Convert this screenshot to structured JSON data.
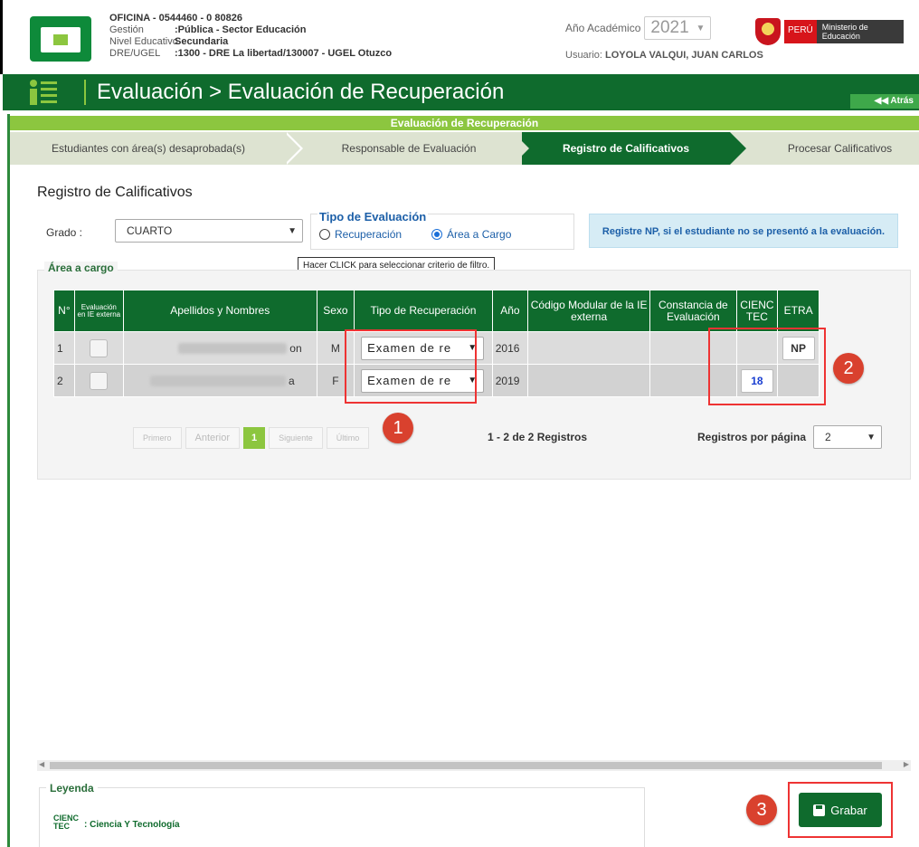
{
  "header": {
    "oficina": "OFICINA - 0544460 - 0  80826",
    "gestion_label": "Gestión",
    "gestion_value": ":Pública - Sector Educación",
    "nivel_label": "Nivel Educativo",
    "nivel_value": "Secundaria",
    "dre_label": "DRE/UGEL",
    "dre_value": ":1300 - DRE La libertad/130007 - UGEL Otuzco",
    "year_label": "Año Académico",
    "year_value": "2021",
    "user_label": "Usuario:",
    "user_value": "LOYOLA VALQUI, JUAN CARLOS",
    "peru": "PERÚ",
    "ministerio": "Ministerio de Educación"
  },
  "title_bar": {
    "title": "Evaluación > Evaluación de Recuperación",
    "back": "◀◀ Atrás"
  },
  "wizard": {
    "strip_title": "Evaluación de Recuperación",
    "steps": [
      "Estudiantes con área(s) desaprobada(s)",
      "Responsable de Evaluación",
      "Registro de Calificativos",
      "Procesar Calificativos"
    ]
  },
  "form": {
    "section_title": "Registro de Calificativos",
    "grado_label": "Grado  :",
    "grado_value": "CUARTO",
    "tipo_title": "Tipo de Evaluación",
    "radio_recuperacion": "Recuperación",
    "radio_area": "Área a Cargo",
    "tooltip": "Hacer CLICK para seleccionar criterio de filtro.",
    "info": "Registre NP, si el estudiante no se presentó a la evaluación.",
    "area_legend": "Área a cargo"
  },
  "table": {
    "headers": {
      "n": "N°",
      "ext": "Evaluación en IE externa",
      "name": "Apellidos y Nombres",
      "sexo": "Sexo",
      "tipo": "Tipo de Recuperación",
      "anio": "Año",
      "codigo": "Código Modular de la IE externa",
      "constancia": "Constancia de Evaluación",
      "cienc": "CIENC TEC",
      "etra": "ETRA"
    },
    "rows": [
      {
        "n": "1",
        "name_tail": "on",
        "sexo": "M",
        "tipo": "Examen de re",
        "anio": "2016",
        "cienc": "",
        "etra": "NP"
      },
      {
        "n": "2",
        "name_tail": "a",
        "sexo": "F",
        "tipo": "Examen de re",
        "anio": "2019",
        "cienc": "18",
        "etra": ""
      }
    ]
  },
  "pagination": {
    "first": "Primero",
    "prev": "Anterior",
    "page": "1",
    "next": "Siguiente",
    "last": "Último",
    "count": "1 - 2 de 2 Registros",
    "rpp_label": "Registros por página",
    "rpp_value": "2"
  },
  "legend": {
    "title": "Leyenda",
    "abbr": "CIENC TEC",
    "desc": ": Ciencia Y Tecnología"
  },
  "actions": {
    "save": "Grabar"
  },
  "annotations": {
    "badge1": "1",
    "badge2": "2",
    "badge3": "3"
  },
  "colors": {
    "primary_green": "#0f6b2d",
    "accent_green": "#8cc63f",
    "highlight_red": "#e33333",
    "link_blue": "#1c5fa8"
  }
}
